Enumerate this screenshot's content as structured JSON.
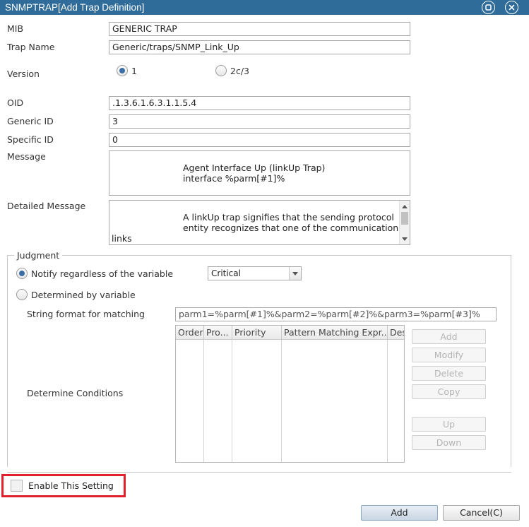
{
  "window": {
    "title": "SNMPTRAP[Add Trap Definition]",
    "icons": [
      "restore-icon",
      "close-icon"
    ]
  },
  "form": {
    "mib_label": "MIB",
    "mib_value": "GENERIC TRAP",
    "trap_name_label": "Trap Name",
    "trap_name_value": "Generic/traps/SNMP_Link_Up",
    "version_label": "Version",
    "version_options": [
      "1",
      "2c/3"
    ],
    "version_selected": "1",
    "oid_label": "OID",
    "oid_value": ".1.3.6.1.6.3.1.1.5.4",
    "generic_id_label": "Generic ID",
    "generic_id_value": "3",
    "specific_id_label": "Specific ID",
    "specific_id_value": "0",
    "message_label": "Message",
    "message_lines": [
      "Agent Interface Up (linkUp Trap)",
      "interface %parm[#1]%"
    ],
    "detailed_label": "Detailed Message",
    "detailed_lines": [
      "A linkUp trap signifies that the sending protocol",
      "entity recognizes that one of the communication",
      "links"
    ]
  },
  "judgment": {
    "legend": "Judgment",
    "notify_label": "Notify regardless of the variable",
    "severity_value": "Critical",
    "determined_label": "Determined by variable",
    "string_format_label": "String format for matching",
    "string_format_value": "parm1=%parm[#1]%&parm2=%parm[#2]%&parm3=%parm[#3]%",
    "conditions_label": "Determine Conditions",
    "columns": [
      "Order",
      "Pro...",
      "Priority",
      "Pattern Matching Expr...",
      "Des"
    ],
    "buttons": {
      "add": "Add",
      "modify": "Modify",
      "delete": "Delete",
      "copy": "Copy",
      "up": "Up",
      "down": "Down"
    }
  },
  "footer": {
    "enable_label": "Enable This Setting",
    "enable_checked": false,
    "add_label": "Add",
    "cancel_label": "Cancel(C)"
  },
  "colors": {
    "titlebar": "#2f6c99",
    "radio_selected": "#3a6ea5",
    "highlight_border": "#e0202a"
  }
}
